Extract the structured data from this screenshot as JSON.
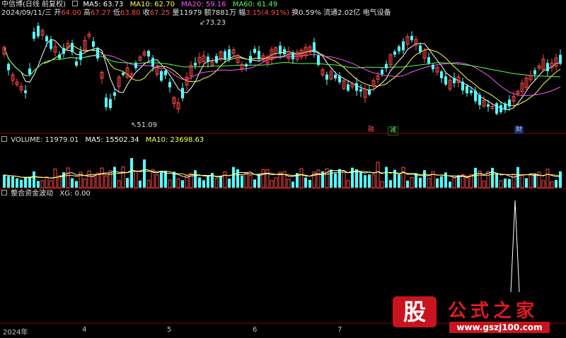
{
  "colors": {
    "up": "#ff4a4a",
    "down": "#54ffff",
    "ma5": "#ffffff",
    "ma10": "#ffff55",
    "ma20": "#ff55ff",
    "ma60": "#55ff55",
    "background": "#000000",
    "separator": "#8b0000"
  },
  "header": {
    "stock_name": "中信博",
    "period": "(日线 前复权)",
    "ma5": "MA5: 63.73",
    "ma10": "MA10: 62.70",
    "ma20": "MA20: 59.16",
    "ma60": "MA60: 61.49"
  },
  "quote": {
    "date": "2024/09/11/三",
    "open_label": "开",
    "open": "64.00",
    "high_label": "高",
    "high": "67.27",
    "low_label": "低",
    "low": "63.80",
    "close_label": "收",
    "close": "67.25",
    "vol_label": "量",
    "vol": "11979",
    "amount_label": "额",
    "amount": "7881万",
    "change_label": "幅",
    "change": "3.15(4.91%)",
    "turnover": "换0.59%",
    "float_cap": "流通2.02亿",
    "sector": "电气设备"
  },
  "price_marks": {
    "high_mark": "73.23",
    "low_mark": "51.09"
  },
  "event_tags": [
    "融",
    "减",
    "财"
  ],
  "volume_panel": {
    "volume": "VOLUME: 11979.01",
    "ma5": "MA5: 15502.34",
    "ma10": "MA10: 23698.63"
  },
  "indicator_panel": {
    "name": "整合资金波动",
    "xg": "XG: 0.00"
  },
  "x_axis": {
    "year": "2024年",
    "months": [
      "4",
      "5",
      "6",
      "7"
    ]
  },
  "watermark": {
    "logo": "股",
    "title": "公式之家",
    "url": "www.gszj100.com"
  }
}
